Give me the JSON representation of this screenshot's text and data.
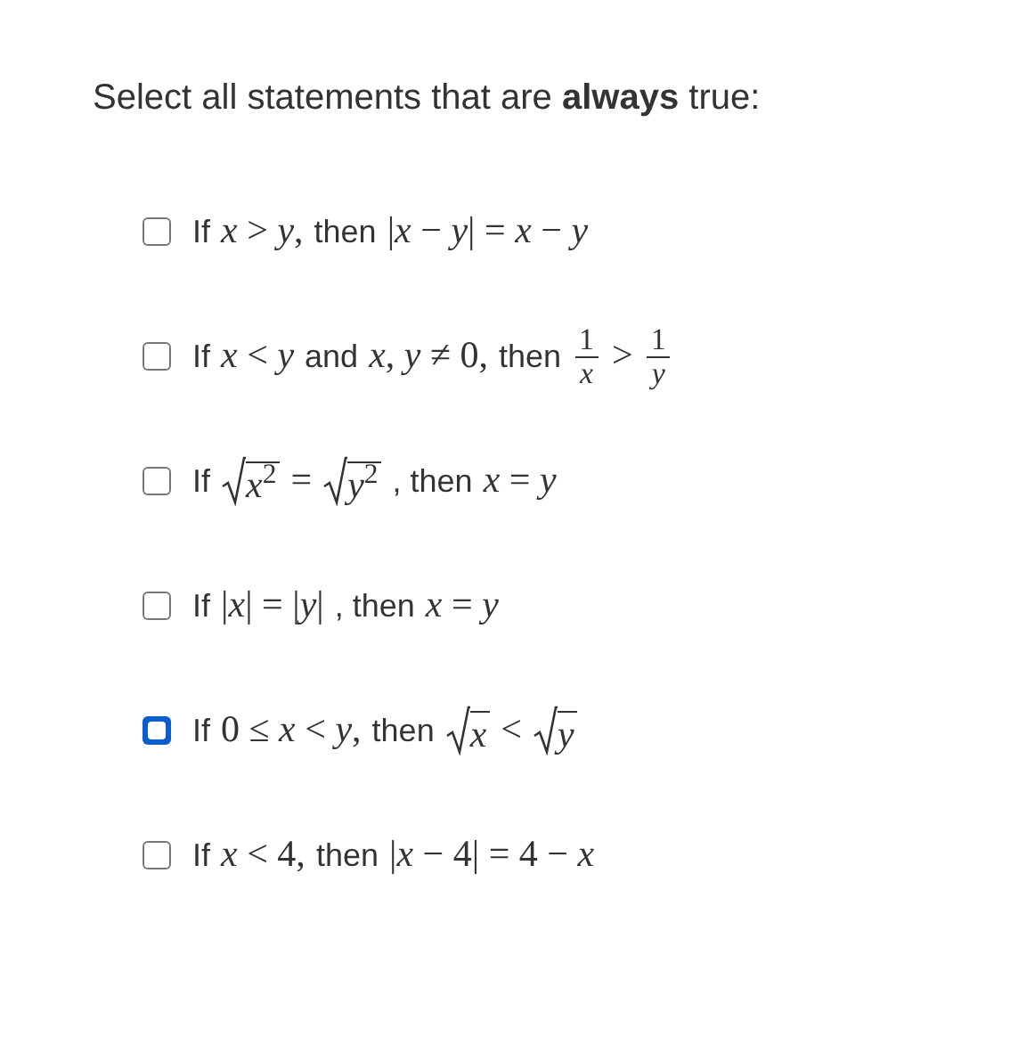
{
  "prompt": "Select all statements that are **always** true:",
  "options": [
    {
      "checked": false,
      "focused": false,
      "parts": [
        {
          "kind": "text",
          "text": "If"
        },
        {
          "kind": "math",
          "text": "*x* > *y*,"
        },
        {
          "kind": "text",
          "text": "then"
        },
        {
          "kind": "math",
          "text": "|*x* − *y*| = *x* − *y*"
        }
      ]
    },
    {
      "checked": false,
      "focused": false,
      "parts": [
        {
          "kind": "text",
          "text": "If"
        },
        {
          "kind": "math",
          "text": "*x* < *y*"
        },
        {
          "kind": "text",
          "text": "and"
        },
        {
          "kind": "math",
          "text": "*x*, *y* ≠ 0,"
        },
        {
          "kind": "text",
          "text": "then"
        },
        {
          "kind": "frac",
          "num": "1",
          "den": "*x*"
        },
        {
          "kind": "math",
          "text": ">"
        },
        {
          "kind": "frac",
          "num": "1",
          "den": "*y*"
        }
      ]
    },
    {
      "checked": false,
      "focused": false,
      "parts": [
        {
          "kind": "text",
          "text": "If"
        },
        {
          "kind": "sqrt",
          "text": "*x*$^{2}$"
        },
        {
          "kind": "math",
          "text": "="
        },
        {
          "kind": "sqrt",
          "text": "*y*$^{2}$"
        },
        {
          "kind": "text",
          "text": ", then"
        },
        {
          "kind": "math",
          "text": "*x* = *y*"
        }
      ]
    },
    {
      "checked": false,
      "focused": false,
      "parts": [
        {
          "kind": "text",
          "text": "If"
        },
        {
          "kind": "math",
          "text": "|*x*| = |*y*|"
        },
        {
          "kind": "text",
          "text": ", then"
        },
        {
          "kind": "math",
          "text": "*x* = *y*"
        }
      ]
    },
    {
      "checked": false,
      "focused": true,
      "parts": [
        {
          "kind": "text",
          "text": "If"
        },
        {
          "kind": "math",
          "text": "0 ≤ *x* < *y*,"
        },
        {
          "kind": "text",
          "text": "then"
        },
        {
          "kind": "sqrt",
          "text": "*x*"
        },
        {
          "kind": "math",
          "text": "<"
        },
        {
          "kind": "sqrt",
          "text": "*y*"
        }
      ]
    },
    {
      "checked": false,
      "focused": false,
      "parts": [
        {
          "kind": "text",
          "text": "If"
        },
        {
          "kind": "math",
          "text": "*x* < 4,"
        },
        {
          "kind": "text",
          "text": "then"
        },
        {
          "kind": "math",
          "text": "|*x* − 4| = 4 − *x*"
        }
      ]
    }
  ]
}
